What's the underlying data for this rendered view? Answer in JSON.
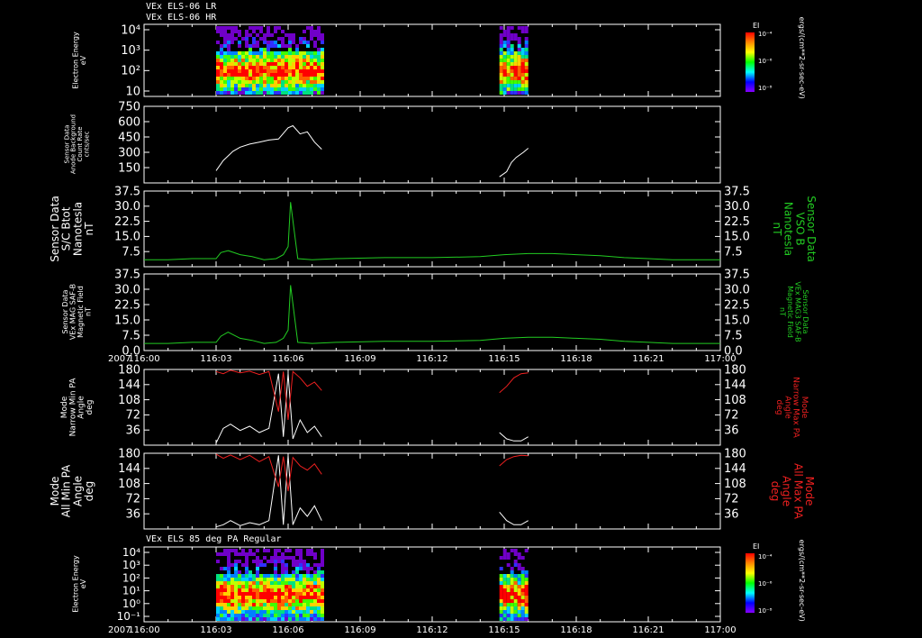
{
  "header": {
    "line1": "VEx ELS-06 LR",
    "line2": "VEx ELS-06 HR"
  },
  "spec2_title": "VEx ELS 85 deg PA Regular",
  "colors": {
    "background": "#000000",
    "axis": "#ffffff",
    "green": "#22cc22",
    "red": "#ee2020",
    "white": "#ffffff"
  },
  "colorbars": [
    {
      "label": "EI",
      "ticks": [
        "10⁻⁴",
        "10⁻⁶",
        "10⁻⁸"
      ]
    },
    {
      "label": "EI",
      "ticks": [
        "10⁻⁴",
        "10⁻⁶",
        "10⁻⁸"
      ]
    }
  ],
  "right_units": "ergs/(cm**2-sr-sec-eV)",
  "chart_data": [
    {
      "type": "heatmap",
      "ylabel": "Electron Energy\neV",
      "yticks": [
        "10⁴",
        "10³",
        "10²",
        "10"
      ],
      "x_range": [
        "116:00",
        "117:00"
      ],
      "data_intervals": [
        [
          "116:03",
          "116:07.5"
        ],
        [
          "116:14.8",
          "116:16"
        ]
      ]
    },
    {
      "type": "line",
      "ylabel": "Sensor Data\nAnode Background\nCount Rate\ncnts/sec",
      "yticks": [
        "750",
        "600",
        "450",
        "300",
        "150"
      ],
      "ylim": [
        0,
        750
      ],
      "series": [
        {
          "x": [
            3.0,
            3.3,
            3.7,
            4.0,
            4.4,
            4.8,
            5.2,
            5.6,
            6.0,
            6.2,
            6.5,
            6.8,
            7.1,
            7.4
          ],
          "y": [
            120,
            220,
            310,
            350,
            380,
            400,
            420,
            430,
            540,
            560,
            480,
            500,
            400,
            330
          ]
        },
        {
          "x": [
            14.8,
            15.1,
            15.3,
            15.5,
            15.8,
            16.0
          ],
          "y": [
            60,
            110,
            200,
            250,
            300,
            340
          ]
        }
      ]
    },
    {
      "type": "line",
      "ylabel": "Sensor Data\nS/C Btot\nNanotesla\nnT",
      "ylabel_right": "Sensor Data\nVSO B\nNanotesla\nnT",
      "yticks": [
        "37.5",
        "30.0",
        "22.5",
        "15.0",
        "7.5"
      ],
      "ylim": [
        0,
        37.5
      ],
      "series": [
        {
          "x": [
            0,
            1,
            2,
            3,
            3.2,
            3.5,
            4,
            4.5,
            5,
            5.5,
            5.8,
            6.0,
            6.1,
            6.4,
            7,
            8,
            10,
            12,
            14,
            15,
            16,
            17,
            18,
            19,
            20,
            21,
            22,
            23,
            24
          ],
          "y": [
            3.5,
            3.5,
            4,
            4,
            7,
            8,
            6,
            5,
            3.5,
            4,
            6,
            10,
            32,
            4,
            3.5,
            4,
            4.5,
            4.5,
            5,
            6,
            6.5,
            6.5,
            6,
            5.5,
            4.5,
            4,
            3.5,
            3.5,
            3.5
          ]
        }
      ]
    },
    {
      "type": "line",
      "ylabel": "Sensor Data\nVEx MAG SAF-B\nMagnetic Field\nnT",
      "ylabel_right": "Sensor Data\nVEx MAG3 SAF-B\nMagnetic Field\nnT",
      "yticks": [
        "37.5",
        "30.0",
        "22.5",
        "15.0",
        "7.5",
        "0.0"
      ],
      "ylim": [
        0,
        37.5
      ],
      "series": [
        {
          "x": [
            0,
            1,
            2,
            3,
            3.2,
            3.5,
            4,
            4.5,
            5,
            5.5,
            5.8,
            6.0,
            6.1,
            6.4,
            7,
            8,
            10,
            12,
            14,
            15,
            16,
            17,
            18,
            19,
            20,
            21,
            22,
            23,
            24
          ],
          "y": [
            3.5,
            3.5,
            4,
            4,
            7,
            9,
            6,
            5,
            3.5,
            4,
            6,
            10,
            32,
            4,
            3.5,
            4,
            4.5,
            4.5,
            5,
            6,
            6.5,
            6.5,
            6,
            5.5,
            4.5,
            4,
            3.5,
            3.5,
            3.5
          ]
        }
      ],
      "x_ticks": [
        "116:00",
        "116:03",
        "116:06",
        "116:09",
        "116:12",
        "116:15",
        "116:18",
        "116:21",
        "117:00"
      ],
      "x_prefix": "2007"
    },
    {
      "type": "line",
      "ylabel": "Mode\nNarrow Min PA\nAngle\ndeg",
      "ylabel_right": "Mode\nNarrow Max PA\nAngle\ndeg",
      "yticks": [
        "180",
        "144",
        "108",
        "72",
        "36"
      ],
      "ylim": [
        0,
        180
      ],
      "series": [
        {
          "name": "min",
          "x": [
            3.0,
            3.3,
            3.6,
            4.0,
            4.4,
            4.8,
            5.2,
            5.6,
            5.8,
            6.0,
            6.2,
            6.5,
            6.8,
            7.1,
            7.4
          ],
          "y": [
            5,
            40,
            50,
            35,
            45,
            30,
            40,
            170,
            20,
            170,
            15,
            60,
            30,
            45,
            20
          ]
        },
        {
          "name": "min2",
          "x": [
            14.8,
            15.1,
            15.4,
            15.7,
            16.0
          ],
          "y": [
            30,
            15,
            10,
            10,
            20
          ]
        },
        {
          "name": "max",
          "x": [
            3.0,
            3.3,
            3.6,
            4.0,
            4.4,
            4.8,
            5.2,
            5.6,
            5.8,
            6.0,
            6.2,
            6.5,
            6.8,
            7.1,
            7.4
          ],
          "y": [
            175,
            170,
            178,
            172,
            176,
            168,
            175,
            80,
            175,
            60,
            175,
            160,
            140,
            150,
            130
          ]
        },
        {
          "name": "max2",
          "x": [
            14.8,
            15.1,
            15.4,
            15.7,
            16.0
          ],
          "y": [
            125,
            140,
            160,
            170,
            172
          ]
        }
      ]
    },
    {
      "type": "line",
      "ylabel": "Mode\nAll Min PA\nAngle\ndeg",
      "ylabel_right": "Mode\nAll Max PA\nAngle\ndeg",
      "yticks": [
        "180",
        "144",
        "108",
        "72",
        "36"
      ],
      "ylim": [
        0,
        180
      ],
      "series": [
        {
          "name": "min",
          "x": [
            3.0,
            3.3,
            3.6,
            4.0,
            4.4,
            4.8,
            5.2,
            5.6,
            5.8,
            6.0,
            6.2,
            6.5,
            6.8,
            7.1,
            7.4
          ],
          "y": [
            5,
            10,
            20,
            8,
            15,
            10,
            20,
            175,
            10,
            175,
            10,
            50,
            30,
            55,
            20
          ]
        },
        {
          "name": "min2",
          "x": [
            14.8,
            15.1,
            15.4,
            15.7,
            16.0
          ],
          "y": [
            40,
            20,
            10,
            10,
            20
          ]
        },
        {
          "name": "max",
          "x": [
            3.0,
            3.3,
            3.6,
            4.0,
            4.4,
            4.8,
            5.2,
            5.6,
            5.8,
            6.0,
            6.2,
            6.5,
            6.8,
            7.1,
            7.4
          ],
          "y": [
            178,
            168,
            176,
            165,
            175,
            160,
            172,
            100,
            172,
            90,
            170,
            150,
            140,
            155,
            130
          ]
        },
        {
          "name": "max2",
          "x": [
            14.8,
            15.1,
            15.4,
            15.7,
            16.0
          ],
          "y": [
            150,
            165,
            172,
            175,
            174
          ]
        }
      ]
    },
    {
      "type": "heatmap",
      "ylabel": "Electron Energy\neV",
      "yticks": [
        "10⁴",
        "10³",
        "10²",
        "10¹",
        "10⁰",
        "10⁻¹"
      ],
      "x_ticks": [
        "116:00",
        "116:03",
        "116:06",
        "116:09",
        "116:12",
        "116:15",
        "116:18",
        "116:21",
        "117:00"
      ],
      "x_prefix": "2007",
      "data_intervals": [
        [
          "116:03",
          "116:07.5"
        ],
        [
          "116:14.8",
          "116:16"
        ]
      ]
    }
  ]
}
